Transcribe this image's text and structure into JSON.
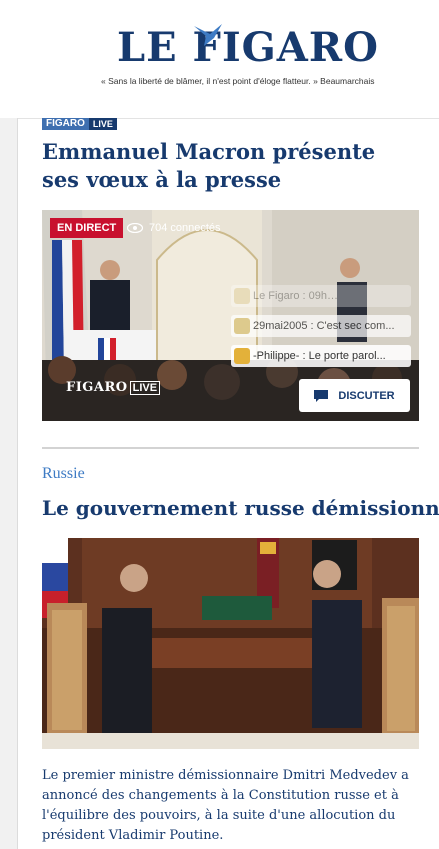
{
  "header": {
    "logo_text": "LE FIGARO",
    "tagline": "« Sans la liberté de blâmer, il n'est point d'éloge flatteur. » Beaumarchais"
  },
  "article1": {
    "badge_figaro": "FIGARO",
    "badge_live": "LIVE",
    "title": "Emmanuel Macron présente ses vœux à la presse",
    "live_label": "EN DIRECT",
    "viewers": "704 connectés",
    "feed": [
      "Le Figaro : 09h…",
      "29mai2005 : C'est sec com...",
      "-Philippe- : Le porte parol..."
    ],
    "discuss_label": "DISCUTER",
    "overlay_figaro": "FIGARO",
    "overlay_live": "LIVE"
  },
  "article2": {
    "kicker": "Russie",
    "title": "Le gouvernement russe démissionne",
    "summary": "Le premier ministre démissionnaire Dmitri Medvedev a annoncé des changements à la Constitution russe et à l'équilibre des pouvoirs, à la suite d'une allocution du président Vladimir Poutine."
  },
  "colors": {
    "brand_navy": "#173a6e",
    "kicker_blue": "#3e7bc4",
    "live_red": "#c8102e"
  }
}
